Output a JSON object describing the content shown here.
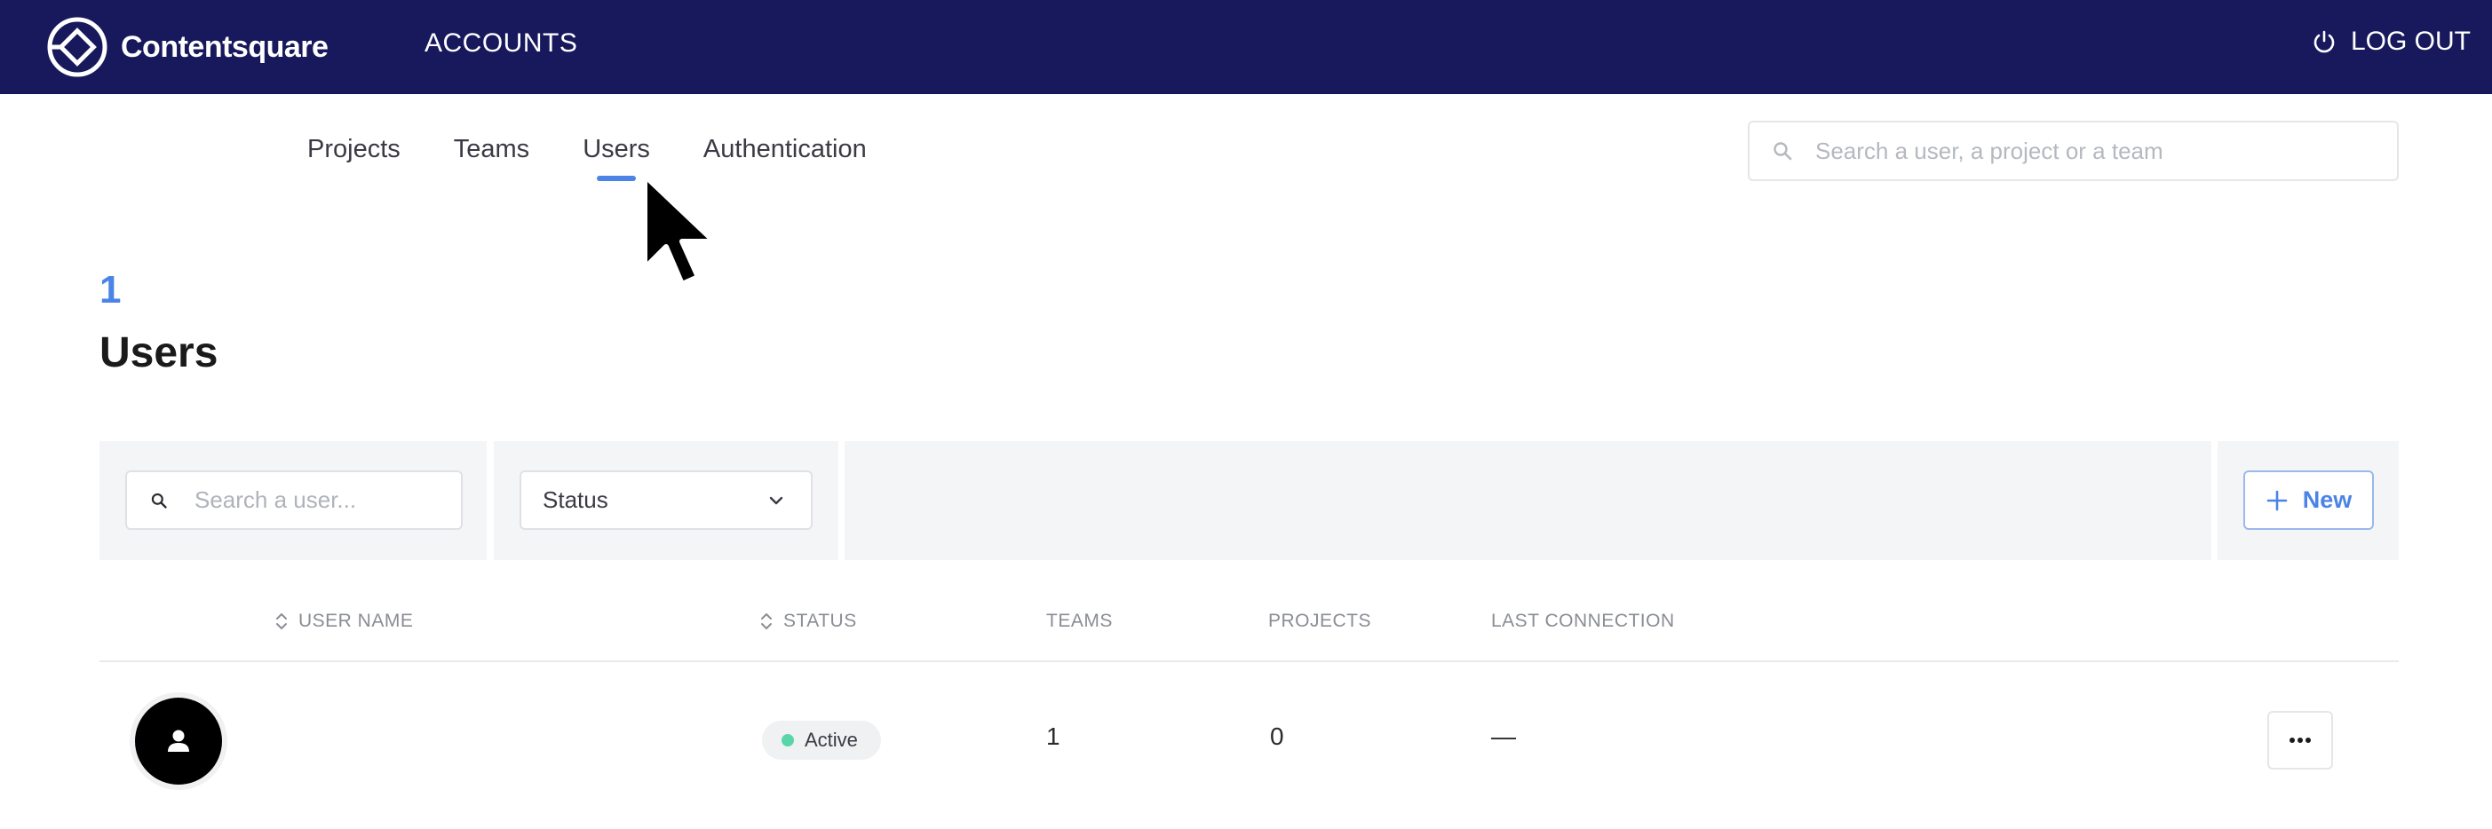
{
  "header": {
    "brand": "Contentsquare",
    "nav_label": "ACCOUNTS",
    "logout_label": "LOG OUT",
    "bg_color": "#18195c"
  },
  "tabs": [
    {
      "label": "Projects",
      "active": false
    },
    {
      "label": "Teams",
      "active": false
    },
    {
      "label": "Users",
      "active": true
    },
    {
      "label": "Authentication",
      "active": false
    }
  ],
  "global_search": {
    "placeholder": "Search a user, a project or a team",
    "value": ""
  },
  "page": {
    "count": "1",
    "title": "Users",
    "accent_color": "#4b84e6"
  },
  "filters": {
    "user_search_placeholder": "Search a user...",
    "status_label": "Status",
    "new_button_label": "New"
  },
  "table": {
    "columns": [
      "USER NAME",
      "STATUS",
      "TEAMS",
      "PROJECTS",
      "LAST CONNECTION"
    ],
    "rows": [
      {
        "user_name": "",
        "status": "Active",
        "teams": "1",
        "projects": "0",
        "last_connection": "—"
      }
    ]
  },
  "icons": [
    "contentsquare-logo-icon",
    "power-icon",
    "search-icon",
    "chevron-down-icon",
    "plus-icon",
    "sort-icon",
    "user-icon",
    "more-horizontal-icon",
    "mouse-pointer-icon"
  ]
}
